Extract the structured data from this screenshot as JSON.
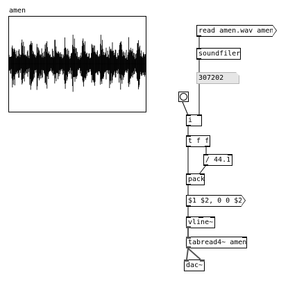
{
  "array": {
    "name": "amen"
  },
  "objects": {
    "read_msg": "read amen.wav amen",
    "soundfiler": "soundfiler",
    "sample_count": "307202",
    "int_obj": "i",
    "trigger": "t f f",
    "divide": "/ 44.1",
    "pack": "pack",
    "line_msg": "$1 $2, 0 0 $2",
    "vline": "vline~",
    "tabread": "tabread4~ amen",
    "dac": "dac~"
  },
  "colors": {
    "background": "#ffffff",
    "box_border": "#000000",
    "atom_fill": "#e6e6e6",
    "signal_wire": "#555555"
  },
  "icons": {
    "bang": "bang-circle-icon"
  }
}
